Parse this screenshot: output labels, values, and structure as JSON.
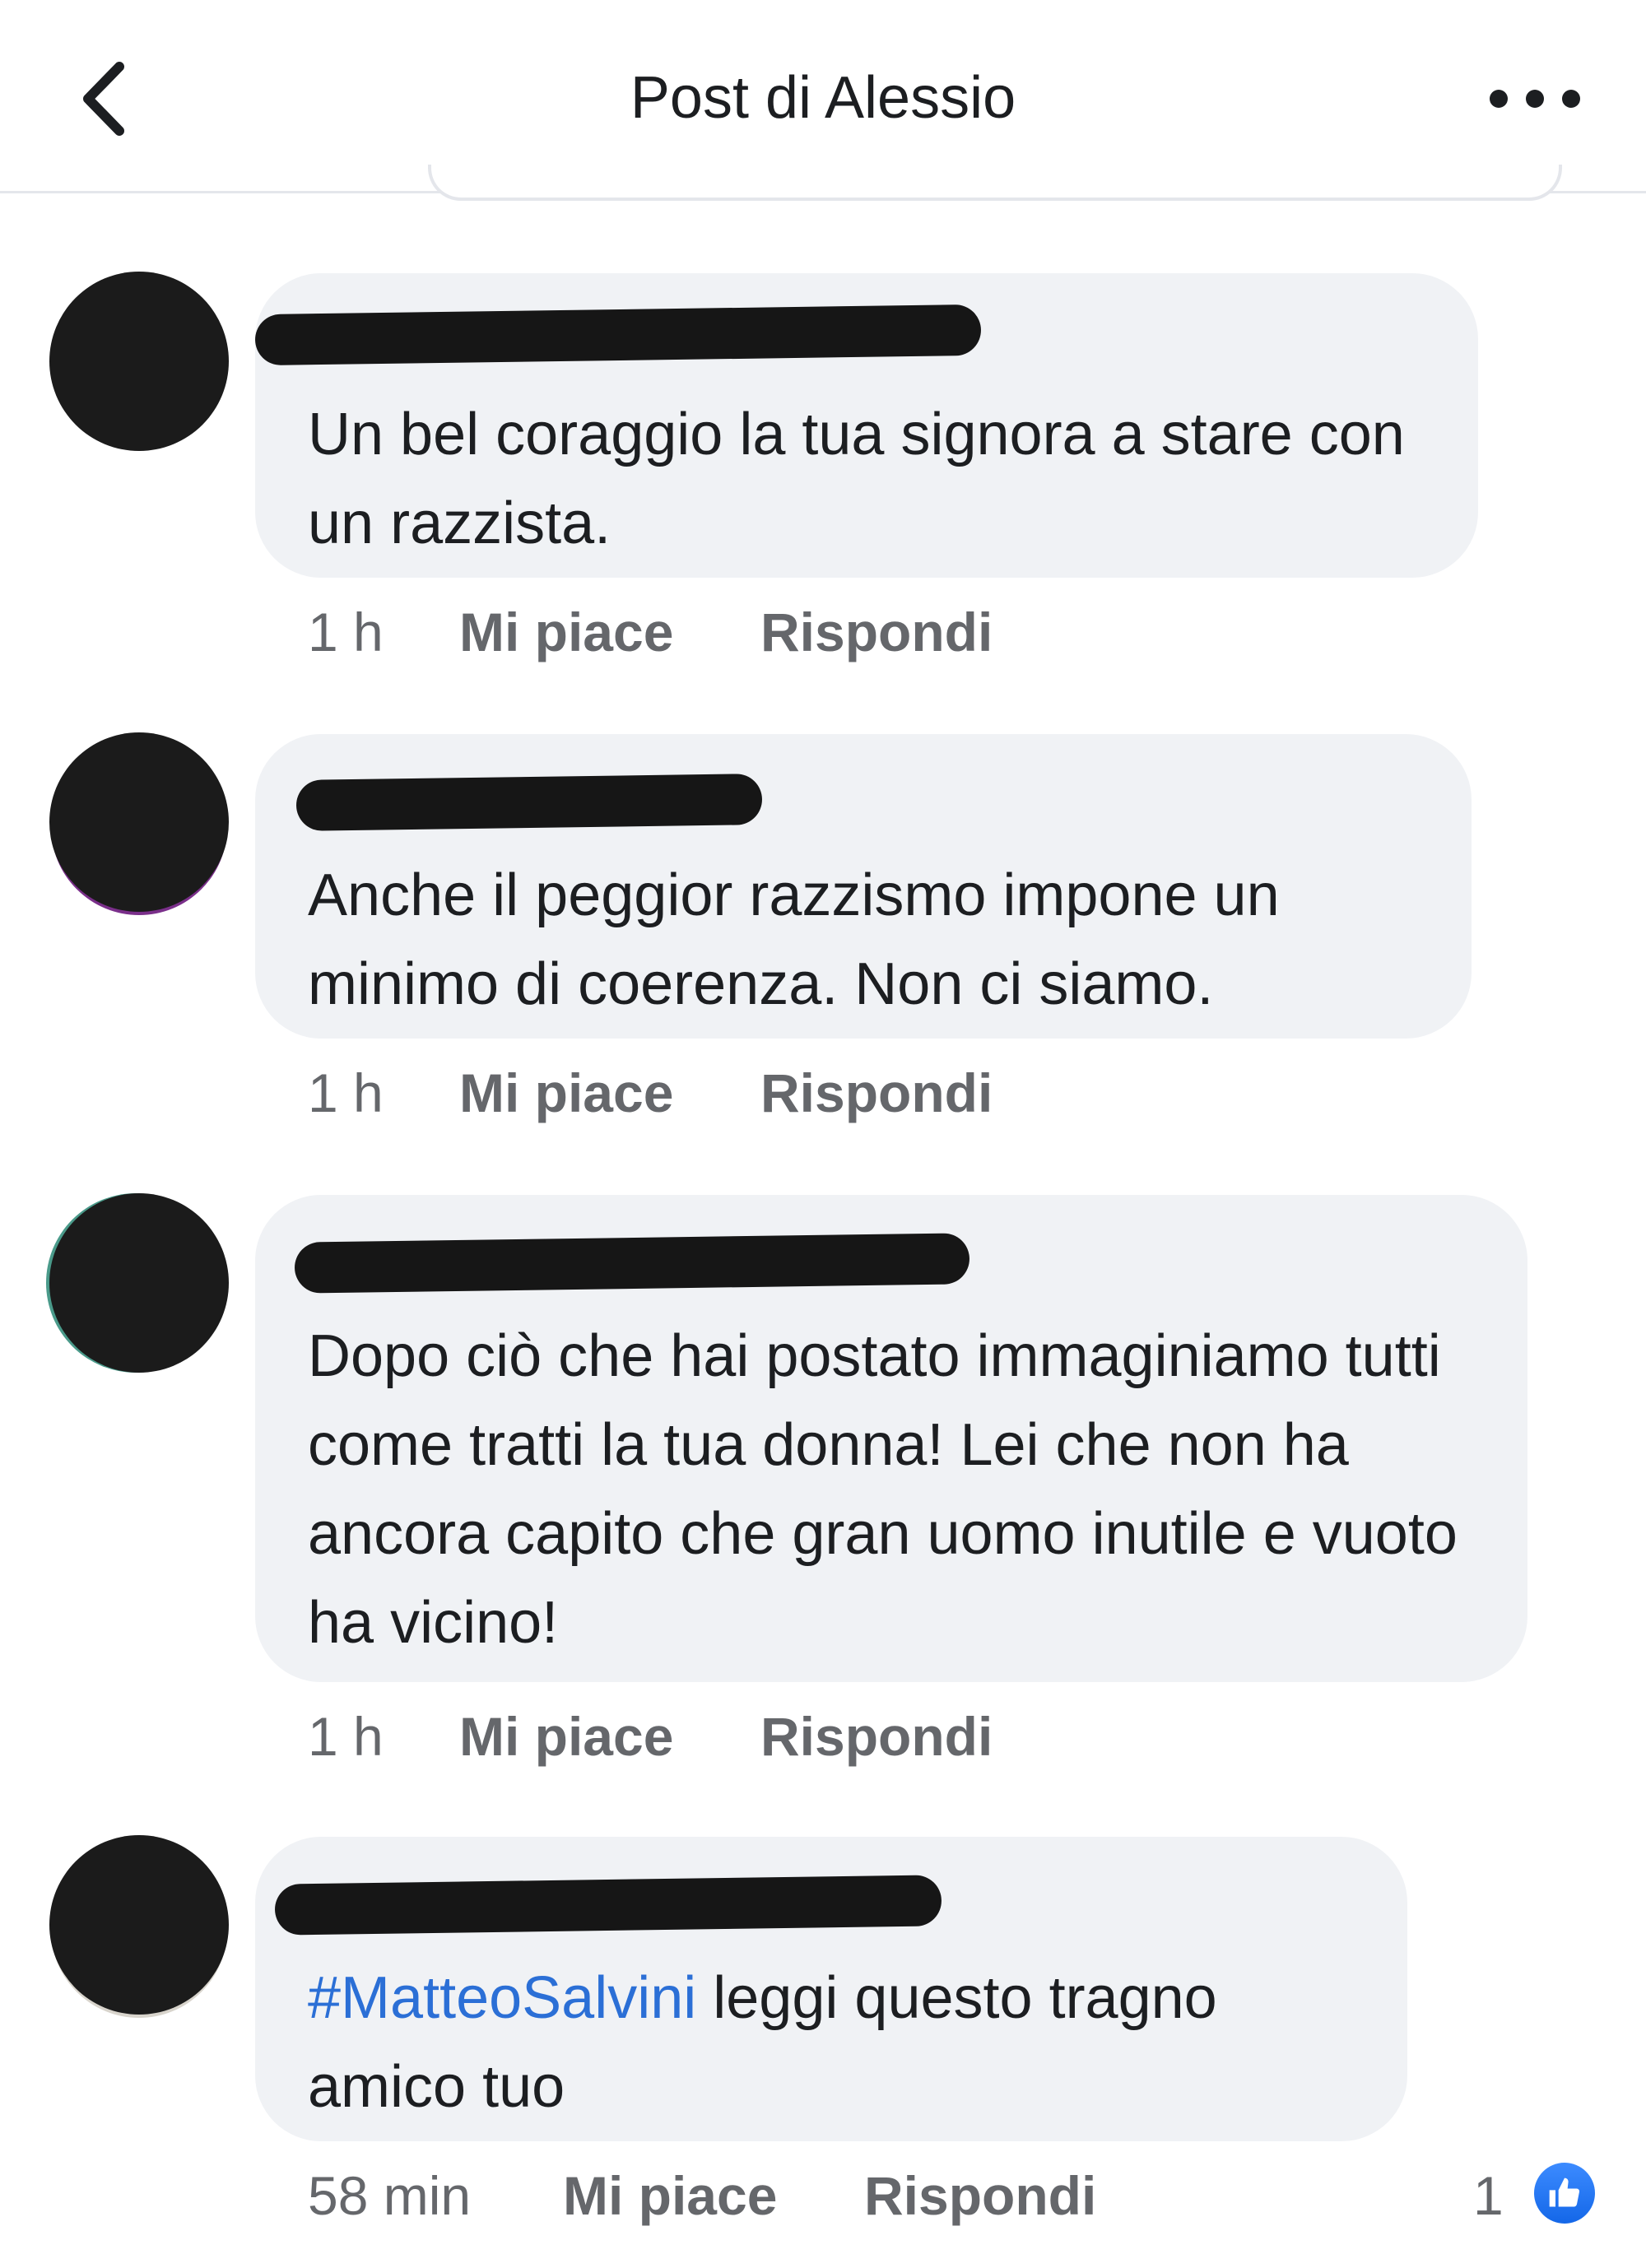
{
  "header": {
    "title": "Post di Alessio"
  },
  "comments": [
    {
      "text": "Un bel coraggio la tua signora a stare con un razzista.",
      "time": "1 h",
      "like_label": "Mi piace",
      "reply_label": "Rispondi"
    },
    {
      "text": "Anche il peggior razzismo impone un minimo di coerenza. Non ci siamo.",
      "time": "1 h",
      "like_label": "Mi piace",
      "reply_label": "Rispondi"
    },
    {
      "text": "Dopo ciò che hai postato immaginiamo tutti come tratti la tua donna! Lei che non ha ancora capito che gran uomo inutile e vuoto ha vicino!",
      "time": "1 h",
      "like_label": "Mi piace",
      "reply_label": "Rispondi"
    },
    {
      "hashtag": "#MatteoSalvini",
      "text": " leggi questo tragno amico tuo",
      "time": "58 min",
      "like_label": "Mi piace",
      "reply_label": "Rispondi",
      "reaction_count": "1",
      "reaction_icon": "thumbs-up-icon"
    }
  ],
  "colors": {
    "bubble": "#f0f2f5",
    "hashtag": "#2b6fd6",
    "meta": "#65676b",
    "like_blue": "#1877f2"
  }
}
